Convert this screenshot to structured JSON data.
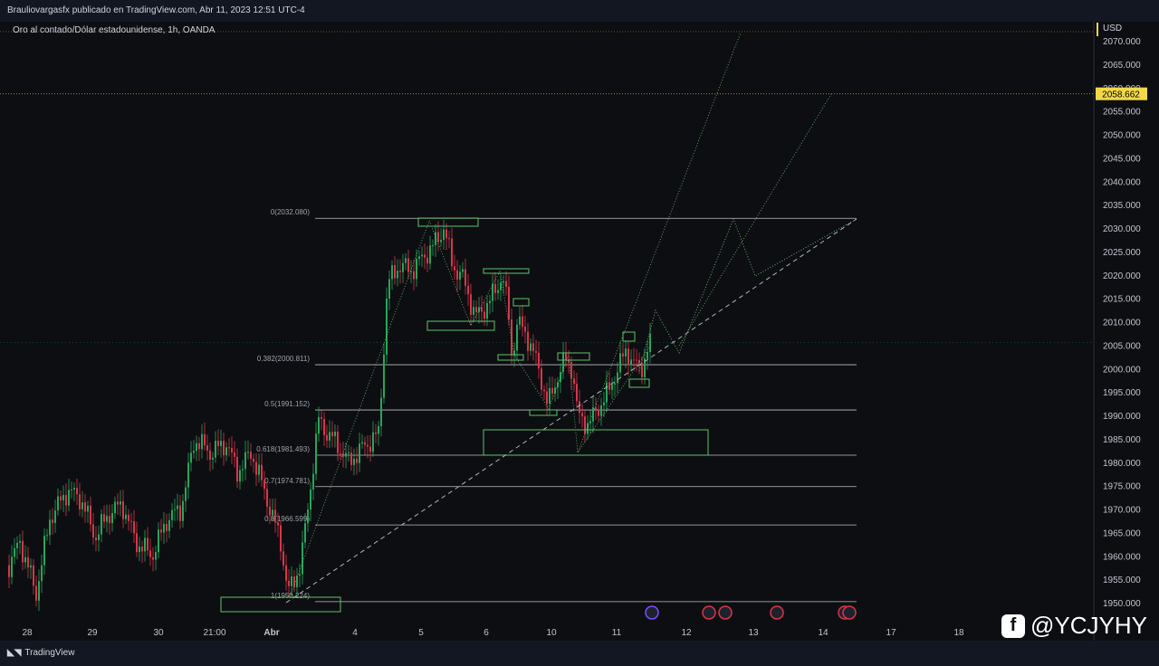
{
  "header": {
    "publisher": "Brauliovargasfx publicado en TradingView.com, Abr 11, 2023 12:51 UTC-4",
    "symbol": "Oro al contado/Dólar estadounidense, 1h, OANDA",
    "currency": "USD"
  },
  "footer": {
    "brand": "TradingView",
    "watermark": "@YCJYHY"
  },
  "colors": {
    "up": "#26a65b",
    "down": "#d9354a",
    "grid": "#c7c7c7",
    "price": "#f0d84a"
  },
  "chart_data": {
    "type": "candlestick",
    "y_ticks": [
      "2070.000",
      "2065.000",
      "2060.000",
      "2055.000",
      "2050.000",
      "2045.000",
      "2040.000",
      "2035.000",
      "2030.000",
      "2025.000",
      "2020.000",
      "2015.000",
      "2010.000",
      "2005.000",
      "2000.000",
      "1995.000",
      "1990.000",
      "1985.000",
      "1980.000",
      "1975.000",
      "1970.000",
      "1965.000",
      "1960.000",
      "1955.000",
      "1950.000"
    ],
    "ylim": [
      1948,
      2071
    ],
    "x_ticks": [
      "28",
      "29",
      "30",
      "21:00",
      "Abr",
      "4",
      "5",
      "6",
      "10",
      "11",
      "12",
      "13",
      "14",
      "17",
      "18"
    ],
    "current_price": "2058.662",
    "fib_levels": [
      {
        "label": "0(2032.080)",
        "value": 2032.08
      },
      {
        "label": "0.382(2000.811)",
        "value": 2000.811
      },
      {
        "label": "0.5(1991.152)",
        "value": 1991.152
      },
      {
        "label": "0.618(1981.493)",
        "value": 1981.493
      },
      {
        "label": "0.7(1974.781)",
        "value": 1974.781
      },
      {
        "label": "0.8(1966.599)",
        "value": 1966.599
      },
      {
        "label": "1(1950.224)",
        "value": 1950.224
      }
    ]
  }
}
